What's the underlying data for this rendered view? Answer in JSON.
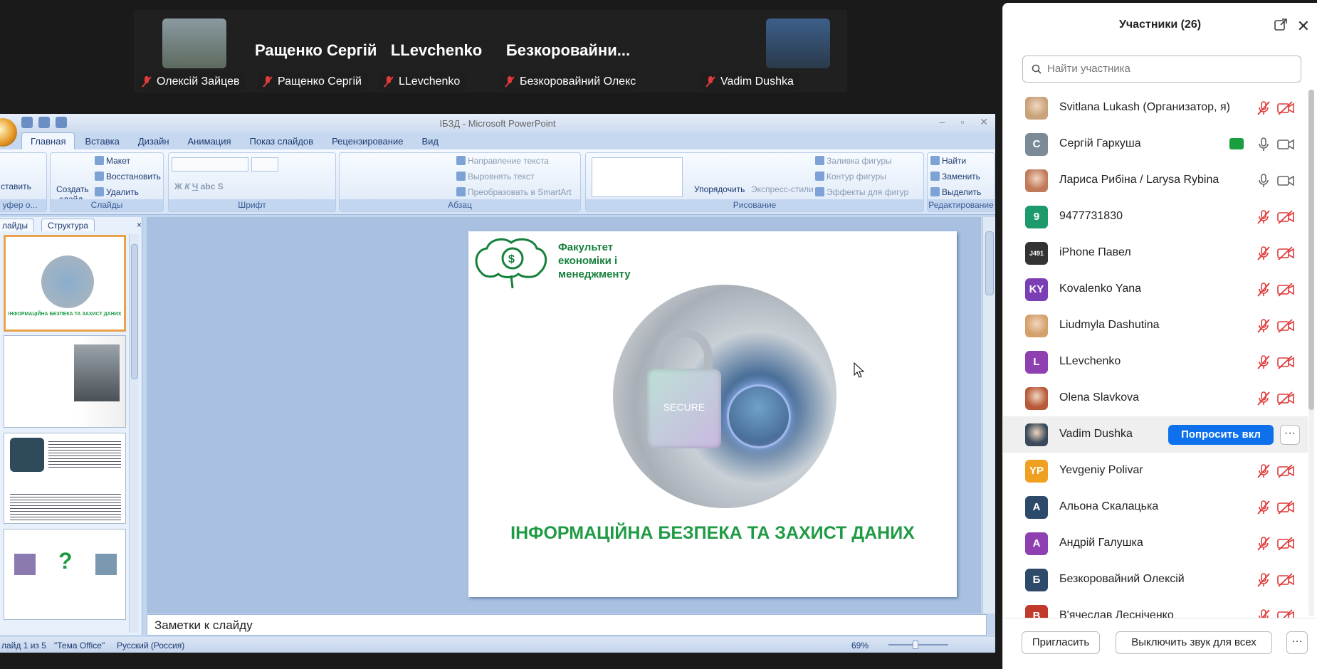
{
  "video_strip": {
    "tiles": [
      {
        "big_name": "",
        "label": "Олексій Зайцев",
        "has_photo": true
      },
      {
        "big_name": "Ращенко Сергій",
        "label": "Ращенко Сергій",
        "has_photo": false
      },
      {
        "big_name": "LLevchenko",
        "label": "LLevchenko",
        "has_photo": false
      },
      {
        "big_name": "Безкоровайни...",
        "label": "Безкоровайний Олекс...",
        "has_photo": false
      },
      {
        "big_name": "",
        "label": "Vadim Dushka",
        "has_photo": true
      }
    ]
  },
  "powerpoint": {
    "window_title": "ІБЗД - Microsoft PowerPoint",
    "tabs": [
      "Главная",
      "Вставка",
      "Дизайн",
      "Анимация",
      "Показ слайдов",
      "Рецензирование",
      "Вид"
    ],
    "ribbon": {
      "clipboard": {
        "paste": "ставить",
        "group": "уфер о..."
      },
      "slides": {
        "create1": "Создать",
        "create2": "слайд",
        "layout": "Макет",
        "reset": "Восстановить",
        "delete": "Удалить",
        "group": "Слайды"
      },
      "font": {
        "group": "Шрифт"
      },
      "paragraph": {
        "direction": "Направление текста",
        "align": "Выровнять текст",
        "smartart": "Преобразовать в SmartArt",
        "group": "Абзац"
      },
      "drawing": {
        "arrange": "Упорядочить",
        "styles": "Экспресс-стили",
        "fill": "Заливка фигуры",
        "outline": "Контур фигуры",
        "effects": "Эффекты для фигур",
        "group": "Рисование"
      },
      "editing": {
        "find": "Найти",
        "replace": "Заменить",
        "select": "Выделить",
        "group": "Редактирование"
      }
    },
    "side_tabs": [
      "лайды",
      "Структура"
    ],
    "slide": {
      "faculty_line1": "Факультет",
      "faculty_line2": "економіки і",
      "faculty_line3": "менеджменту",
      "lock_text": "SECURE",
      "title": "ІНФОРМАЦІЙНА БЕЗПЕКА ТА ЗАХИСТ ДАНИХ"
    },
    "thumb1_title": "ІНФОРМАЦІЙНА БЕЗПЕКА ТА ЗАХИСТ ДАНИХ",
    "notes_placeholder": "Заметки к слайду",
    "status": {
      "slide": "лайд 1 из 5",
      "theme": "\"Тема Office\"",
      "lang": "Русский (Россия)",
      "zoom": "69%"
    }
  },
  "participants": {
    "title": "Участники (26)",
    "search_placeholder": "Найти участника",
    "ask_button": "Попросить вкл",
    "more_label": "···",
    "list": [
      {
        "name": "Svitlana Lukash (Организатор, я)",
        "initials": "",
        "color": "#c8a27a",
        "muted": true,
        "photo": true
      },
      {
        "name": "Сергій Гаркуша",
        "initials": "С",
        "color": "#7a8a96",
        "muted": false,
        "sharing": true
      },
      {
        "name": "Лариса Рибіна / Larysa Rybina",
        "initials": "",
        "color": "#c07a5a",
        "muted": false,
        "photo": true
      },
      {
        "name": "9477731830",
        "initials": "9",
        "color": "#1d9a6c",
        "muted": true
      },
      {
        "name": "iPhone Павел",
        "initials": "J491",
        "color": "#333333",
        "muted": true
      },
      {
        "name": "Kovalenko Yana",
        "initials": "KY",
        "color": "#7b3fb5",
        "muted": true
      },
      {
        "name": "Liudmyla Dashutina",
        "initials": "",
        "color": "#d4a06a",
        "muted": true,
        "photo": true
      },
      {
        "name": "LLevchenko",
        "initials": "L",
        "color": "#8e3fb0",
        "muted": true
      },
      {
        "name": "Olena Slavkova",
        "initials": "",
        "color": "#b85a3a",
        "muted": true,
        "photo": true
      },
      {
        "name": "Vadim Dushka",
        "initials": "",
        "color": "#3a4a5a",
        "muted": true,
        "photo": true,
        "highlight": true
      },
      {
        "name": "Yevgeniy Polivar",
        "initials": "YP",
        "color": "#f0a020",
        "muted": true
      },
      {
        "name": "Альона Скалацька",
        "initials": "А",
        "color": "#2e4a6a",
        "muted": true
      },
      {
        "name": "Андрій Галушка",
        "initials": "А",
        "color": "#8e3fb0",
        "muted": true
      },
      {
        "name": "Безкоровайний Олексій",
        "initials": "Б",
        "color": "#2e4a6a",
        "muted": true
      },
      {
        "name": "В'ячеслав Лесніченко",
        "initials": "В",
        "color": "#c0392b",
        "muted": true
      }
    ],
    "footer": {
      "invite": "Пригласить",
      "mute_all": "Выключить звук для всех",
      "more": "···"
    }
  }
}
